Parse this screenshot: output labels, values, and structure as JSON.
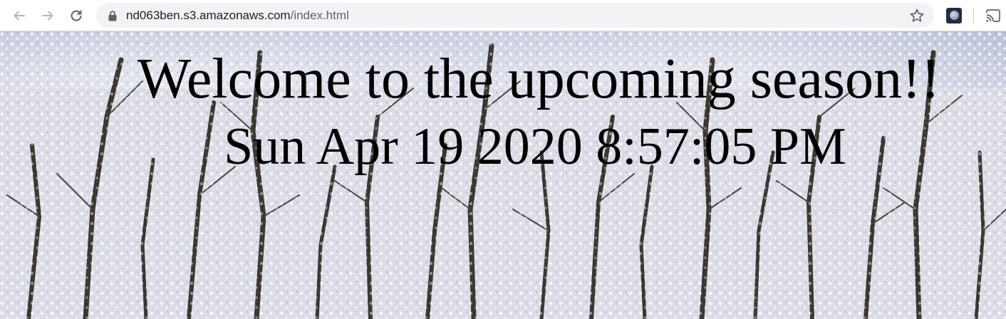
{
  "browser": {
    "url_host": "nd063ben.s3.amazonaws.com",
    "url_path": "/index.html",
    "icons": {
      "back": "arrow-left-icon",
      "forward": "arrow-right-icon",
      "reload": "reload-icon",
      "secure": "lock-icon",
      "bookmark": "star-icon",
      "extension": "moon-extension-icon",
      "cast": "cast-icon"
    }
  },
  "page": {
    "heading": "Welcome to the upcoming season!!",
    "datetime": "Sun Apr 19 2020 8:57:05 PM"
  },
  "colors": {
    "text": "#000000",
    "omnibox": "#f1f3f4",
    "sky": "#b9bfd8",
    "snow": "#e6e6ec",
    "bark": "#3a3632"
  }
}
